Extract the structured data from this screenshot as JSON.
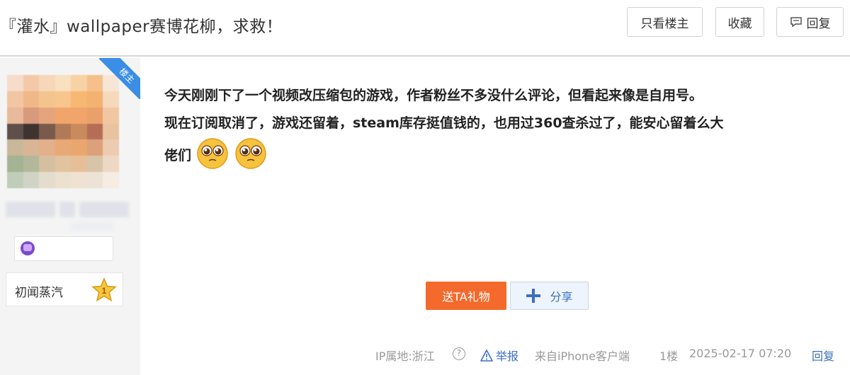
{
  "header": {
    "title": "『灌水』wallpaper赛博花柳，求救！",
    "btn_only_op": "只看楼主",
    "btn_favorite": "收藏",
    "btn_reply": "回复"
  },
  "sidebar": {
    "op_badge": "楼主",
    "level_name": "初闻蒸汽",
    "level_number": "1"
  },
  "post": {
    "line1": "今天刚刚下了一个视频改压缩包的游戏，作者粉丝不多没什么评论，但看起来像是自用号。",
    "line2": "现在订阅取消了，游戏还留着，steam库存挺值钱的，也用过360查杀过了，能安心留着么大",
    "line3": "佬们",
    "gift_label": "送TA礼物",
    "share_label": "分享"
  },
  "footer": {
    "ip_location": "IP属地:浙江",
    "help_glyph": "?",
    "report": "举报",
    "source": "来自iPhone客户端",
    "floor": "1楼",
    "datetime": "2025-02-17 07:20",
    "reply": "回复"
  },
  "colors": {
    "accent_blue": "#3b6fbf",
    "gift_orange": "#f36a2c",
    "badge_blue": "#3a8ee6"
  }
}
